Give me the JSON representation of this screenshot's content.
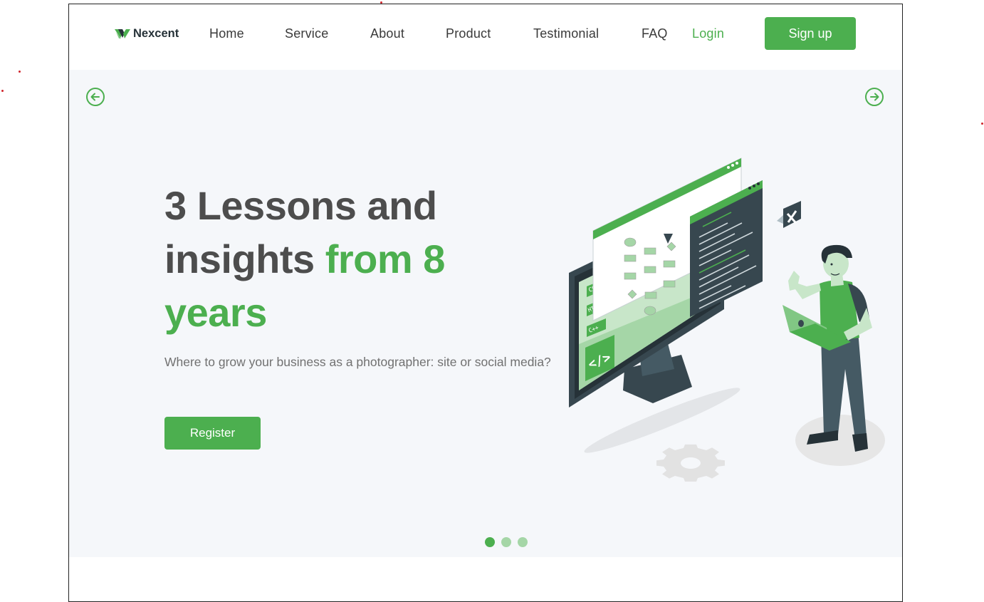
{
  "brand": {
    "name": "Nexcent",
    "accent_color": "#4caf4f",
    "text_color": "#263238",
    "icon": "nexcent-logo-icon"
  },
  "nav": {
    "items": [
      {
        "label": "Home"
      },
      {
        "label": "Service"
      },
      {
        "label": "About"
      },
      {
        "label": "Product"
      },
      {
        "label": "Testimonial"
      },
      {
        "label": "FAQ"
      }
    ],
    "login_label": "Login",
    "signup_label": "Sign up"
  },
  "hero": {
    "headline_line1": "3 Lessons and",
    "headline_line2_plain": "insights ",
    "headline_line2_accent": "from 8",
    "headline_line3_accent": "years",
    "subtext": "Where to grow your business as a photographer: site or social media?",
    "register_label": "Register",
    "prev_icon": "arrow-left-circle-icon",
    "next_icon": "arrow-right-circle-icon",
    "illustration": "developer-with-laptop-illustration",
    "code_labels": [
      "CSS",
      "HTML",
      "C++"
    ],
    "slides_total": 3,
    "active_slide": 1,
    "background_color": "#f5f7fa"
  }
}
